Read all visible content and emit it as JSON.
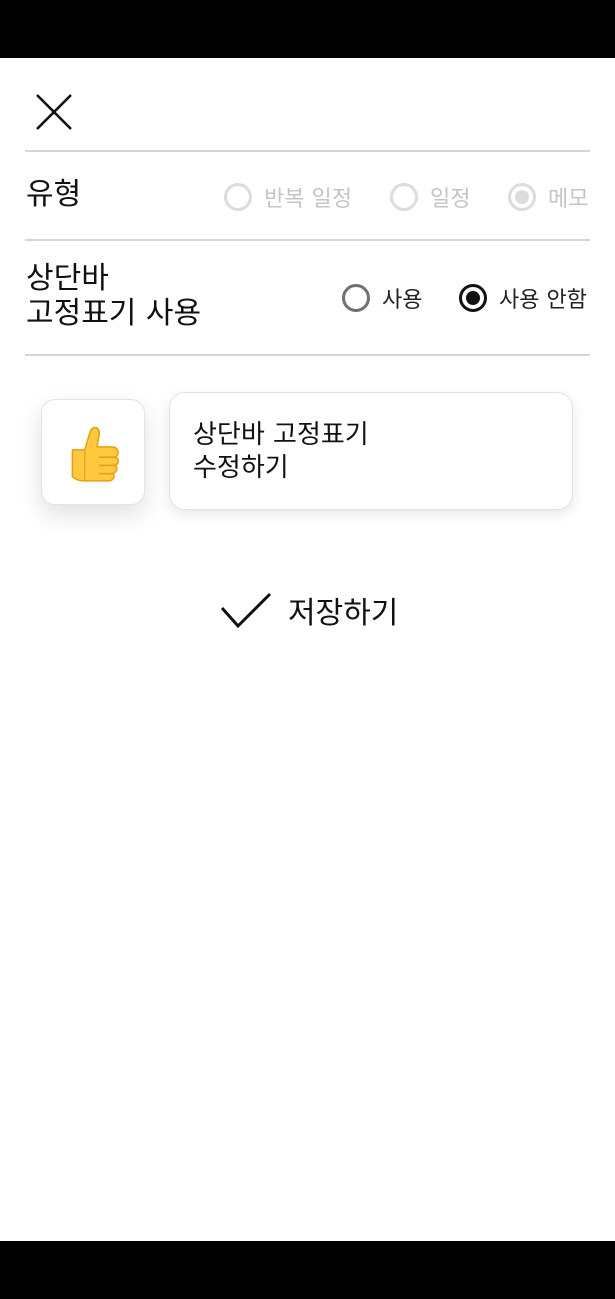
{
  "header": {
    "close_icon": "close-icon"
  },
  "type_row": {
    "label": "유형",
    "options": [
      {
        "label": "반복 일정",
        "selected": false,
        "disabled": true
      },
      {
        "label": "일정",
        "selected": false,
        "disabled": true
      },
      {
        "label": "메모",
        "selected": true,
        "disabled": true
      }
    ]
  },
  "pin_row": {
    "label_line1": "상단바",
    "label_line2": "고정표기 사용",
    "options": [
      {
        "label": "사용",
        "selected": false
      },
      {
        "label": "사용 안함",
        "selected": true
      }
    ]
  },
  "editor": {
    "emoji": "👍",
    "emoji_icon": "thumbs-up-icon",
    "text_line1": "상단바 고정표기",
    "text_line2": "수정하기"
  },
  "save": {
    "label": "저장하기",
    "icon": "check-icon"
  }
}
